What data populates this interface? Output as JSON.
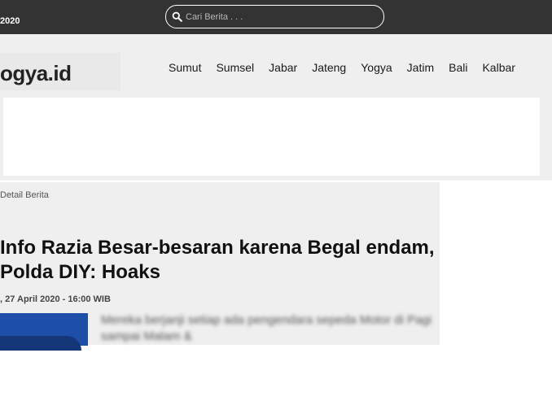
{
  "topbar": {
    "date_text": "2020",
    "search_placeholder": "Cari Berita . . ."
  },
  "header": {
    "logo_text": "ogya.id",
    "nav": [
      "Sumut",
      "Sumsel",
      "Jabar",
      "Jateng",
      "Yogya",
      "Jatim",
      "Bali",
      "Kalbar"
    ]
  },
  "article": {
    "breadcrumb": "Detail Berita",
    "title": "Info Razia Besar-besaran karena Begal endam, Polda DIY: Hoaks",
    "meta": ", 27 April 2020 - 16:00 WIB",
    "excerpt": "Mereka berjanji setiap ada pengendara sepeda Motor di Pagi sampai Malam &"
  },
  "colors": {
    "topbar_bg": "#333333",
    "header_bg": "#efefef",
    "thumb_blue": "#1e4fa8"
  }
}
